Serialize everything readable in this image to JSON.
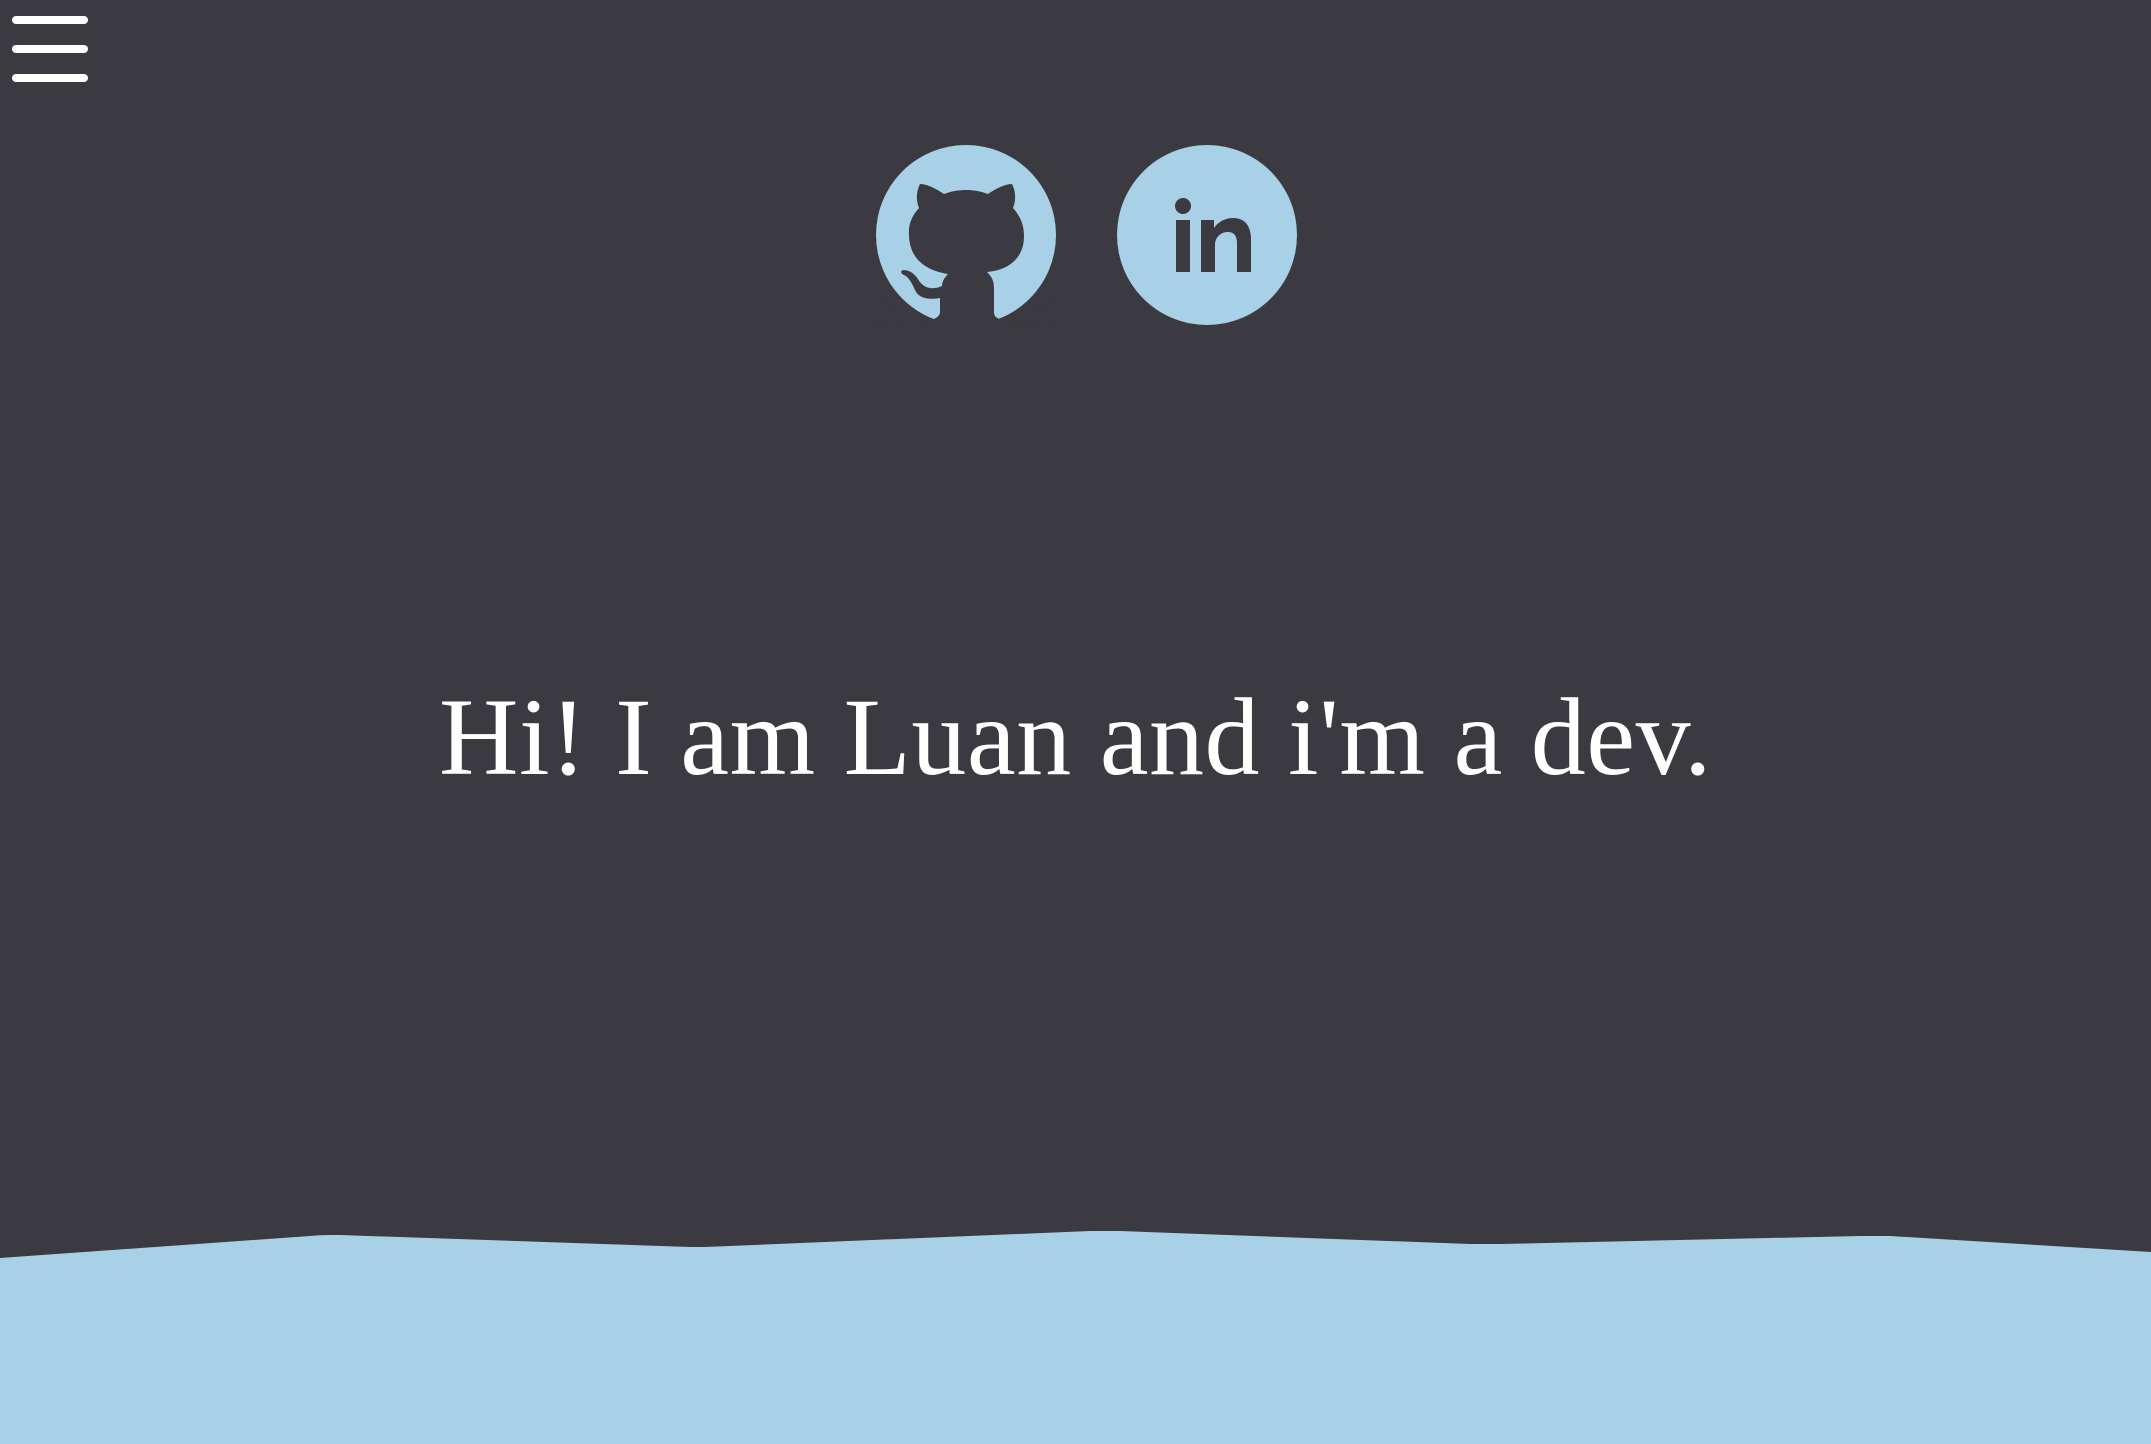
{
  "menu": {
    "icon": "hamburger-menu-icon"
  },
  "social": {
    "github": {
      "icon": "github-icon"
    },
    "linkedin": {
      "icon": "linkedin-icon",
      "text": "in"
    }
  },
  "hero": {
    "title": "Hi! I am Luan and i'm a dev."
  },
  "colors": {
    "background": "#3b3a41",
    "accent": "#a8d0e6",
    "text": "#ffffff"
  }
}
